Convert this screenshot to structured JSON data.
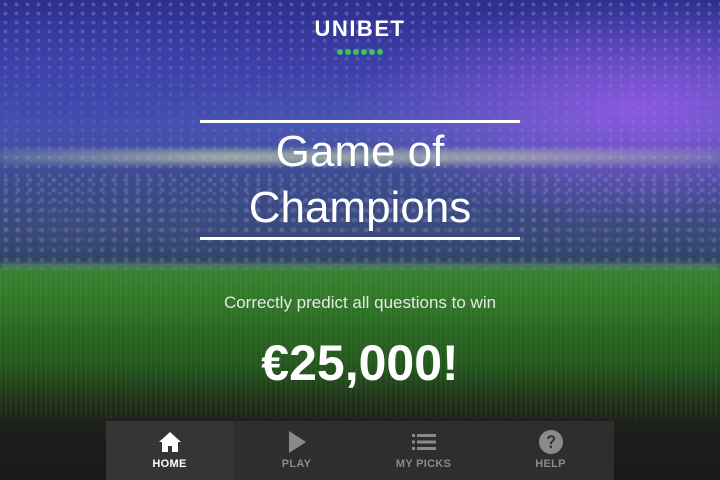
{
  "brand": {
    "name": "UNIBET",
    "dot_count": 6,
    "accent_color": "#34c759"
  },
  "hero": {
    "title_line1": "Game of",
    "title_line2": "Champions",
    "subtitle": "Correctly predict all questions to win",
    "prize": "€25,000!"
  },
  "nav": {
    "items": [
      {
        "label": "HOME",
        "icon": "home-icon",
        "active": true
      },
      {
        "label": "PLAY",
        "icon": "play-icon",
        "active": false
      },
      {
        "label": "MY PICKS",
        "icon": "list-icon",
        "active": false
      },
      {
        "label": "HELP",
        "icon": "help-icon",
        "active": false
      }
    ]
  }
}
